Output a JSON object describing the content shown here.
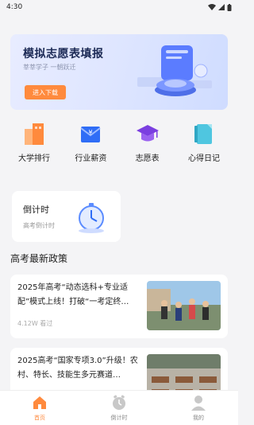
{
  "status": {
    "time": "4:30"
  },
  "banner": {
    "title": "模拟志愿表填报",
    "subtitle": "莘莘学子 一朝跃迁",
    "button": "进入下载"
  },
  "quick_nav": [
    {
      "label": "大学排行",
      "icon": "building-icon"
    },
    {
      "label": "行业薪资",
      "icon": "salary-card-icon"
    },
    {
      "label": "志愿表",
      "icon": "graduation-cap-icon"
    },
    {
      "label": "心得日记",
      "icon": "diary-book-icon"
    }
  ],
  "countdown": {
    "title": "倒计时",
    "subtitle": "高考倒计时"
  },
  "section_title": "高考最新政策",
  "news": [
    {
      "title": "2025年高考“动态选科+专业适配”模式上线！打破“一考定终…",
      "meta": "4.12W 看过"
    },
    {
      "title": "2025高考“国家专项3.0”升级！农村、特长、技能生多元赛道…",
      "meta": ""
    }
  ],
  "tabs": [
    {
      "label": "首页",
      "icon": "home-icon",
      "active": true
    },
    {
      "label": "倒计时",
      "icon": "clock-icon",
      "active": false
    },
    {
      "label": "我的",
      "icon": "user-icon",
      "active": false
    }
  ],
  "colors": {
    "accent": "#ff8a3d",
    "banner_bg": "#dfe6ff"
  }
}
